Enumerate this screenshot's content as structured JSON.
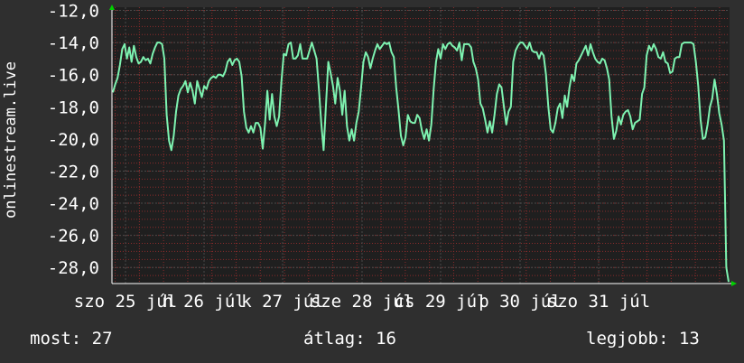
{
  "chart_data": {
    "type": "line",
    "ylabel": "onlinestream.live",
    "ylim": [
      -29.0,
      -11.8
    ],
    "y_ticks": [
      "-12,0",
      "-14,0",
      "-16,0",
      "-18,0",
      "-20,0",
      "-22,0",
      "-24,0",
      "-26,0",
      "-28,0"
    ],
    "x_tick_labels": [
      "szo 25 júl",
      "h 26 júl",
      "k 27 júl",
      "sze 28 júl",
      "cs 29 júl",
      "p 30 júl",
      "szo 31 júl"
    ],
    "grid": true,
    "colors": {
      "background": "#2f2f2f",
      "plot_background": "#1f1f1f",
      "line": "#7ef2b0",
      "minor_grid": "#8a2b2b",
      "major_grid": "#4a4a4a",
      "axis_arrow": "#00d000"
    },
    "series": [
      {
        "values": [
          -17.1,
          -16.6,
          -16.2,
          -15.4,
          -14.4,
          -14.1,
          -15.0,
          -14.3,
          -15.2,
          -14.2,
          -14.9,
          -15.3,
          -15.2,
          -14.9,
          -15.1,
          -15.0,
          -15.3,
          -14.7,
          -14.3,
          -14.0,
          -14.0,
          -14.1,
          -15.0,
          -18.5,
          -20.1,
          -20.7,
          -19.8,
          -18.3,
          -17.3,
          -16.9,
          -16.7,
          -16.4,
          -17.1,
          -16.5,
          -17.0,
          -17.8,
          -16.4,
          -16.9,
          -17.4,
          -16.7,
          -16.9,
          -16.4,
          -16.2,
          -16.1,
          -16.2,
          -16.0,
          -16.0,
          -16.1,
          -15.8,
          -15.2,
          -15.0,
          -15.4,
          -15.1,
          -15.0,
          -15.2,
          -16.1,
          -18.3,
          -19.3,
          -19.6,
          -19.2,
          -19.6,
          -19.0,
          -19.0,
          -19.3,
          -20.6,
          -19.0,
          -17.0,
          -18.8,
          -17.2,
          -18.6,
          -19.2,
          -18.6,
          -16.4,
          -14.7,
          -14.8,
          -14.1,
          -14.0,
          -15.0,
          -15.0,
          -14.8,
          -14.1,
          -15.0,
          -15.0,
          -15.0,
          -14.5,
          -14.0,
          -14.5,
          -15.0,
          -16.9,
          -19.0,
          -20.7,
          -17.9,
          -15.2,
          -15.9,
          -16.7,
          -17.8,
          -16.2,
          -17.0,
          -18.5,
          -17.0,
          -19.2,
          -20.1,
          -19.4,
          -20.1,
          -19.0,
          -18.3,
          -16.8,
          -15.2,
          -14.6,
          -14.9,
          -15.6,
          -15.0,
          -14.5,
          -14.1,
          -14.4,
          -14.2,
          -14.0,
          -14.1,
          -14.0,
          -14.6,
          -14.9,
          -16.8,
          -18.2,
          -19.8,
          -20.4,
          -19.9,
          -18.5,
          -18.9,
          -19.0,
          -19.0,
          -18.5,
          -18.7,
          -19.5,
          -20.0,
          -19.4,
          -20.1,
          -19.1,
          -16.9,
          -15.2,
          -14.4,
          -15.0,
          -14.1,
          -14.4,
          -14.1,
          -14.0,
          -14.2,
          -14.3,
          -14.5,
          -14.0,
          -15.1,
          -14.1,
          -14.1,
          -14.1,
          -14.3,
          -15.2,
          -15.6,
          -16.3,
          -17.8,
          -18.1,
          -18.8,
          -19.6,
          -18.9,
          -19.6,
          -18.5,
          -17.2,
          -16.6,
          -16.8,
          -18.0,
          -19.1,
          -18.3,
          -18.0,
          -15.2,
          -14.5,
          -14.2,
          -14.0,
          -14.0,
          -14.2,
          -14.4,
          -14.0,
          -14.5,
          -14.6,
          -14.6,
          -15.0,
          -14.6,
          -14.8,
          -16.0,
          -18.0,
          -19.4,
          -19.6,
          -19.0,
          -18.1,
          -17.8,
          -18.7,
          -17.3,
          -18.0,
          -16.8,
          -16.0,
          -16.4,
          -15.3,
          -15.1,
          -14.8,
          -14.5,
          -14.2,
          -14.8,
          -14.1,
          -14.6,
          -15.0,
          -15.2,
          -15.3,
          -15.0,
          -15.1,
          -15.6,
          -16.3,
          -18.6,
          -20.0,
          -19.5,
          -18.6,
          -19.1,
          -18.5,
          -18.3,
          -18.2,
          -18.6,
          -19.4,
          -19.0,
          -18.9,
          -18.8,
          -17.2,
          -16.8,
          -14.8,
          -14.2,
          -14.5,
          -14.1,
          -14.4,
          -14.9,
          -15.0,
          -14.6,
          -15.2,
          -15.3,
          -15.9,
          -15.8,
          -15.0,
          -14.9,
          -14.9,
          -14.1,
          -14.0,
          -14.0,
          -14.0,
          -14.0,
          -14.1,
          -15.2,
          -16.7,
          -18.8,
          -20.0,
          -19.9,
          -19.1,
          -18.0,
          -17.5,
          -16.3,
          -17.2,
          -18.4,
          -19.1,
          -20.1,
          -28.0,
          -28.9
        ]
      }
    ],
    "summary": {
      "now_label": "most: 27",
      "avg_label": "átlag: 16",
      "best_label": "legjobb: 13"
    }
  }
}
